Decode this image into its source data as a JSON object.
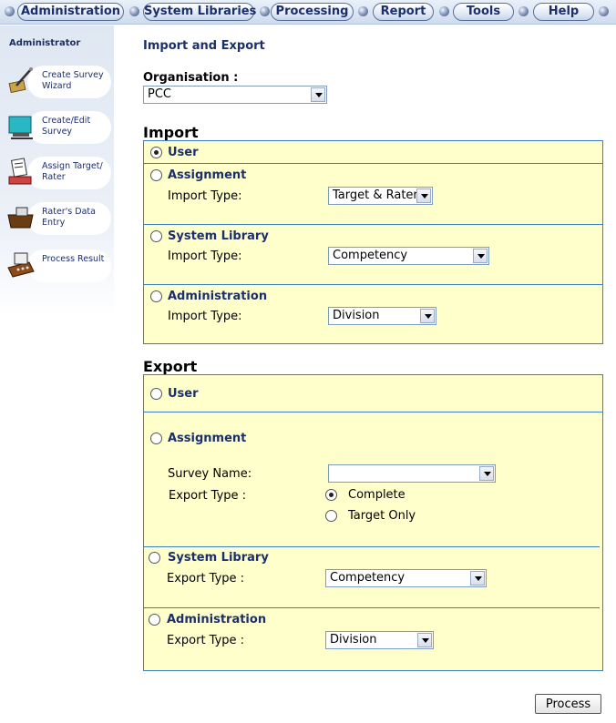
{
  "nav": {
    "tabs": [
      {
        "label": "Administration"
      },
      {
        "label": "System Libraries"
      },
      {
        "label": "Processing"
      },
      {
        "label": "Report"
      },
      {
        "label": "Tools"
      },
      {
        "label": "Help"
      }
    ]
  },
  "sidebar": {
    "title": "Administrator",
    "items": [
      {
        "label": "Create Survey Wizard",
        "icon": "wizard-pen-icon"
      },
      {
        "label": "Create/Edit Survey",
        "icon": "edit-survey-icon"
      },
      {
        "label": "Assign Target/ Rater",
        "icon": "assign-papers-icon"
      },
      {
        "label": "Rater's Data Entry",
        "icon": "data-entry-icon"
      },
      {
        "label": "Process Result",
        "icon": "calculator-icon"
      }
    ]
  },
  "main": {
    "title": "Import and Export",
    "organisation": {
      "label": "Organisation :",
      "value": "PCC"
    },
    "import": {
      "heading": "Import",
      "user_label": "User",
      "assignment": {
        "label": "Assignment",
        "type_label": "Import Type:",
        "type_value": "Target & Rater"
      },
      "system_library": {
        "label": "System Library",
        "type_label": "Import Type:",
        "type_value": "Competency"
      },
      "administration": {
        "label": "Administration",
        "type_label": "Import Type:",
        "type_value": "Division"
      }
    },
    "export": {
      "heading": "Export",
      "user_label": "User",
      "assignment": {
        "label": "Assignment",
        "survey_name_label": "Survey Name:",
        "survey_name_value": "",
        "type_label": "Export Type :",
        "complete_label": "Complete",
        "target_only_label": "Target Only"
      },
      "system_library": {
        "label": "System Library",
        "type_label": "Export Type :",
        "type_value": "Competency"
      },
      "administration": {
        "label": "Administration",
        "type_label": "Export Type :",
        "type_value": "Division"
      }
    },
    "process_label": "Process"
  }
}
